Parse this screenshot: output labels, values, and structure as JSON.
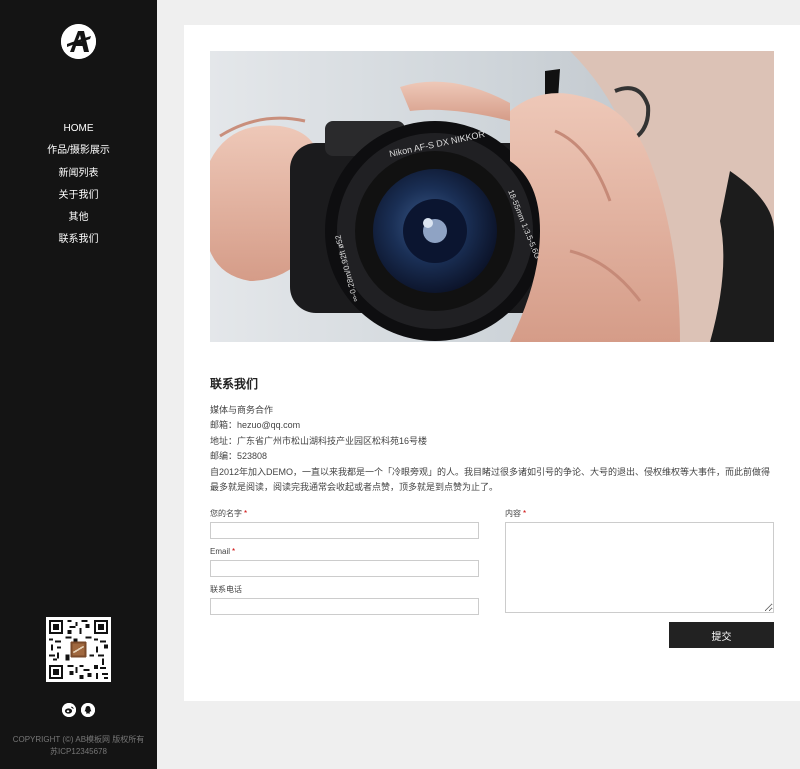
{
  "sidebar": {
    "logo_letter": "A",
    "nav": [
      "HOME",
      "作品/摄影展示",
      "新闻列表",
      "关于我们",
      "其他",
      "联系我们"
    ],
    "icons": [
      "weibo-icon",
      "qq-icon"
    ],
    "copyright": "COPYRIGHT (©) AB模板网 版权所有",
    "icp": "苏ICP12345678"
  },
  "hero": {
    "lens_text_top": "Nikon AF-S DX NIKKOR",
    "lens_text_right": "18-55mm 1:3.5-5.6G VR II",
    "lens_text_left": "∞-0.28m/0.92ft ø52"
  },
  "content": {
    "title": "联系我们",
    "lines": [
      "媒体与商务合作",
      "邮箱：hezuo@qq.com",
      "地址：广东省广州市松山湖科技产业园区松科苑16号楼",
      "邮编：523808",
      "自2012年加入DEMO，一直以来我都是一个「冷眼旁观」的人。我目睹过很多诸如引号的争论、大号的退出、侵权维权等大事件，而此前做得最多就是阅读，阅读完我通常会收起或者点赞，顶多就是到点赞为止了。"
    ]
  },
  "form": {
    "name_label": "您的名字",
    "email_label": "Email",
    "phone_label": "联系电话",
    "content_label": "内容",
    "required_mark": "*",
    "submit_label": "提交"
  },
  "colors": {
    "sidebar_bg": "#141414",
    "page_bg": "#efefef",
    "button_bg": "#222222",
    "required": "#cc0000"
  }
}
